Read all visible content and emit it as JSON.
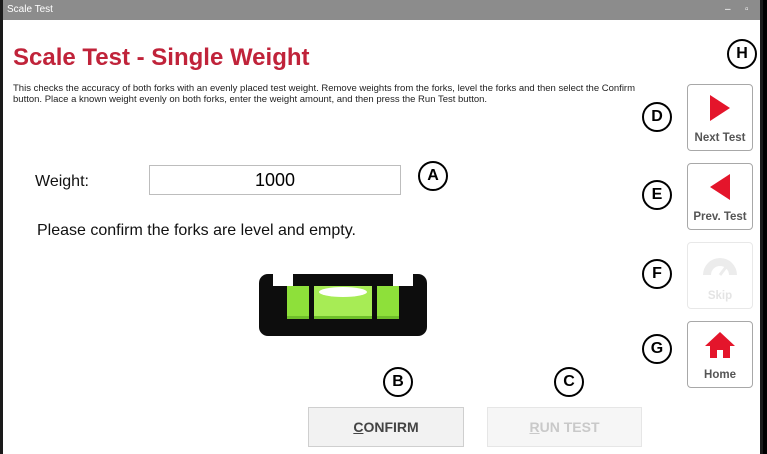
{
  "window": {
    "title": "Scale Test",
    "minimize_glyph": "–",
    "maximize_glyph": "▫"
  },
  "page": {
    "title": "Scale Test - Single Weight",
    "description": "This checks the accuracy of both forks with an evenly placed test weight. Remove weights from the forks, level the forks and then select the Confirm button. Place a known weight evenly on both forks, enter the weight amount, and then press the Run Test button.",
    "weight_label": "Weight:",
    "weight_value": "1000",
    "confirm_message": "Please confirm the forks are level and empty."
  },
  "buttons": {
    "confirm": {
      "first": "C",
      "rest": "ONFIRM"
    },
    "run_test": {
      "first": "R",
      "rest": "UN TEST"
    }
  },
  "nav": {
    "next_test": "Next Test",
    "prev_test": "Prev. Test",
    "skip": "Skip",
    "home": "Home"
  },
  "markers": {
    "a": "A",
    "b": "B",
    "c": "C",
    "d": "D",
    "e": "E",
    "f": "F",
    "g": "G",
    "h": "H"
  },
  "colors": {
    "accent_red": "#c0233a",
    "icon_red": "#e4152b",
    "level_green": "#8ee03a"
  },
  "icons": {
    "next": "play-right-icon",
    "prev": "play-left-icon",
    "skip": "gauge-icon",
    "home": "home-icon",
    "level": "spirit-level-icon"
  }
}
